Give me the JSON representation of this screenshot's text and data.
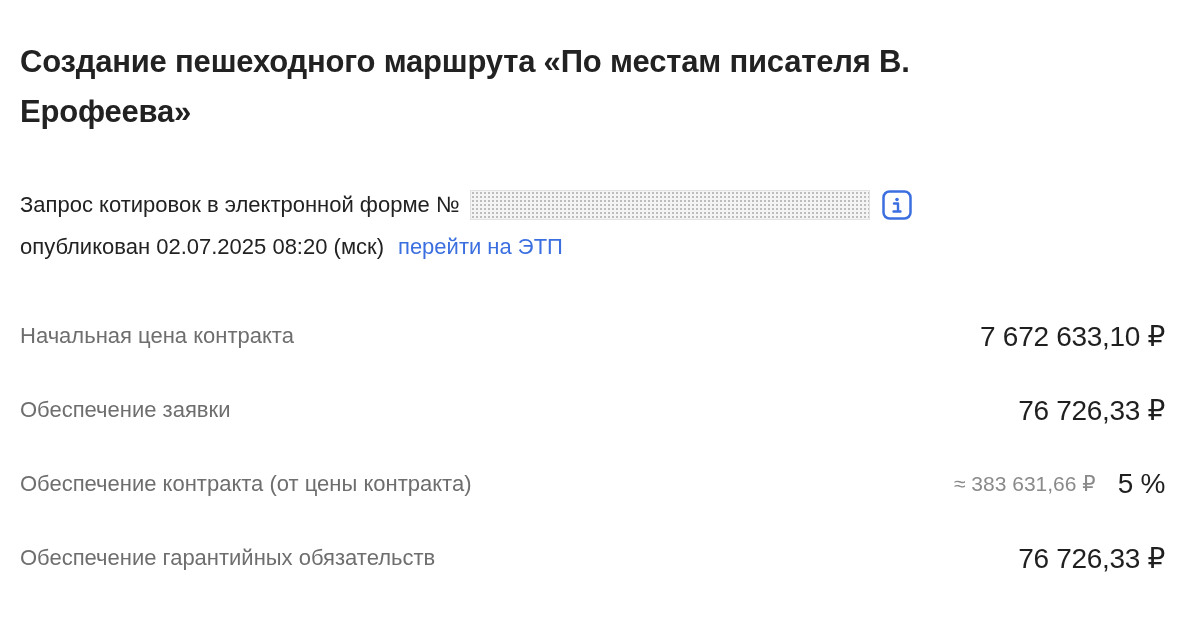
{
  "title": "Создание пешеходного маршрута «По местам писателя В. Ерофеева»",
  "notice": {
    "label": "Запрос котировок в электронной форме №",
    "published": "опубликован 02.07.2025 08:20 (мск)",
    "link": "перейти на ЭТП"
  },
  "details": [
    {
      "label": "Начальная цена контракта",
      "value": "7 672 633,10 ₽"
    },
    {
      "label": "Обеспечение заявки",
      "value": "76 726,33 ₽"
    },
    {
      "label": "Обеспечение контракта (от цены контракта)",
      "approx": "≈ 383 631,66 ₽",
      "value": "5 %"
    },
    {
      "label": "Обеспечение гарантийных обязательств",
      "value": "76 726,33 ₽"
    }
  ]
}
